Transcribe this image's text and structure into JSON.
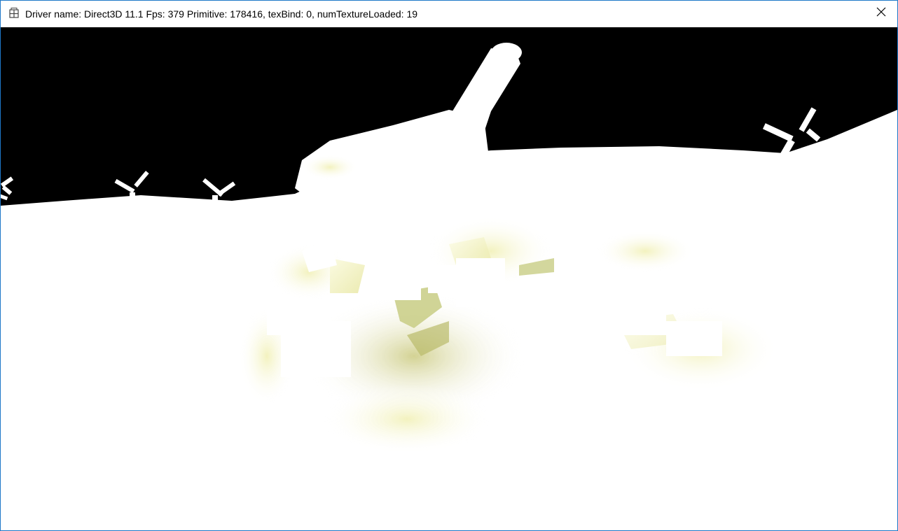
{
  "window": {
    "title": "Driver name: Direct3D 11.1 Fps: 379 Primitive: 178416, texBind: 0, numTextureLoaded: 19",
    "app_icon": "app-grid-icon",
    "close_icon": "close-icon"
  },
  "scene": {
    "sky_color": "#000000",
    "ground_color": "#ffffff",
    "accent_tint": "#f2f0c0",
    "shadow_tint": "#cfd08a"
  }
}
